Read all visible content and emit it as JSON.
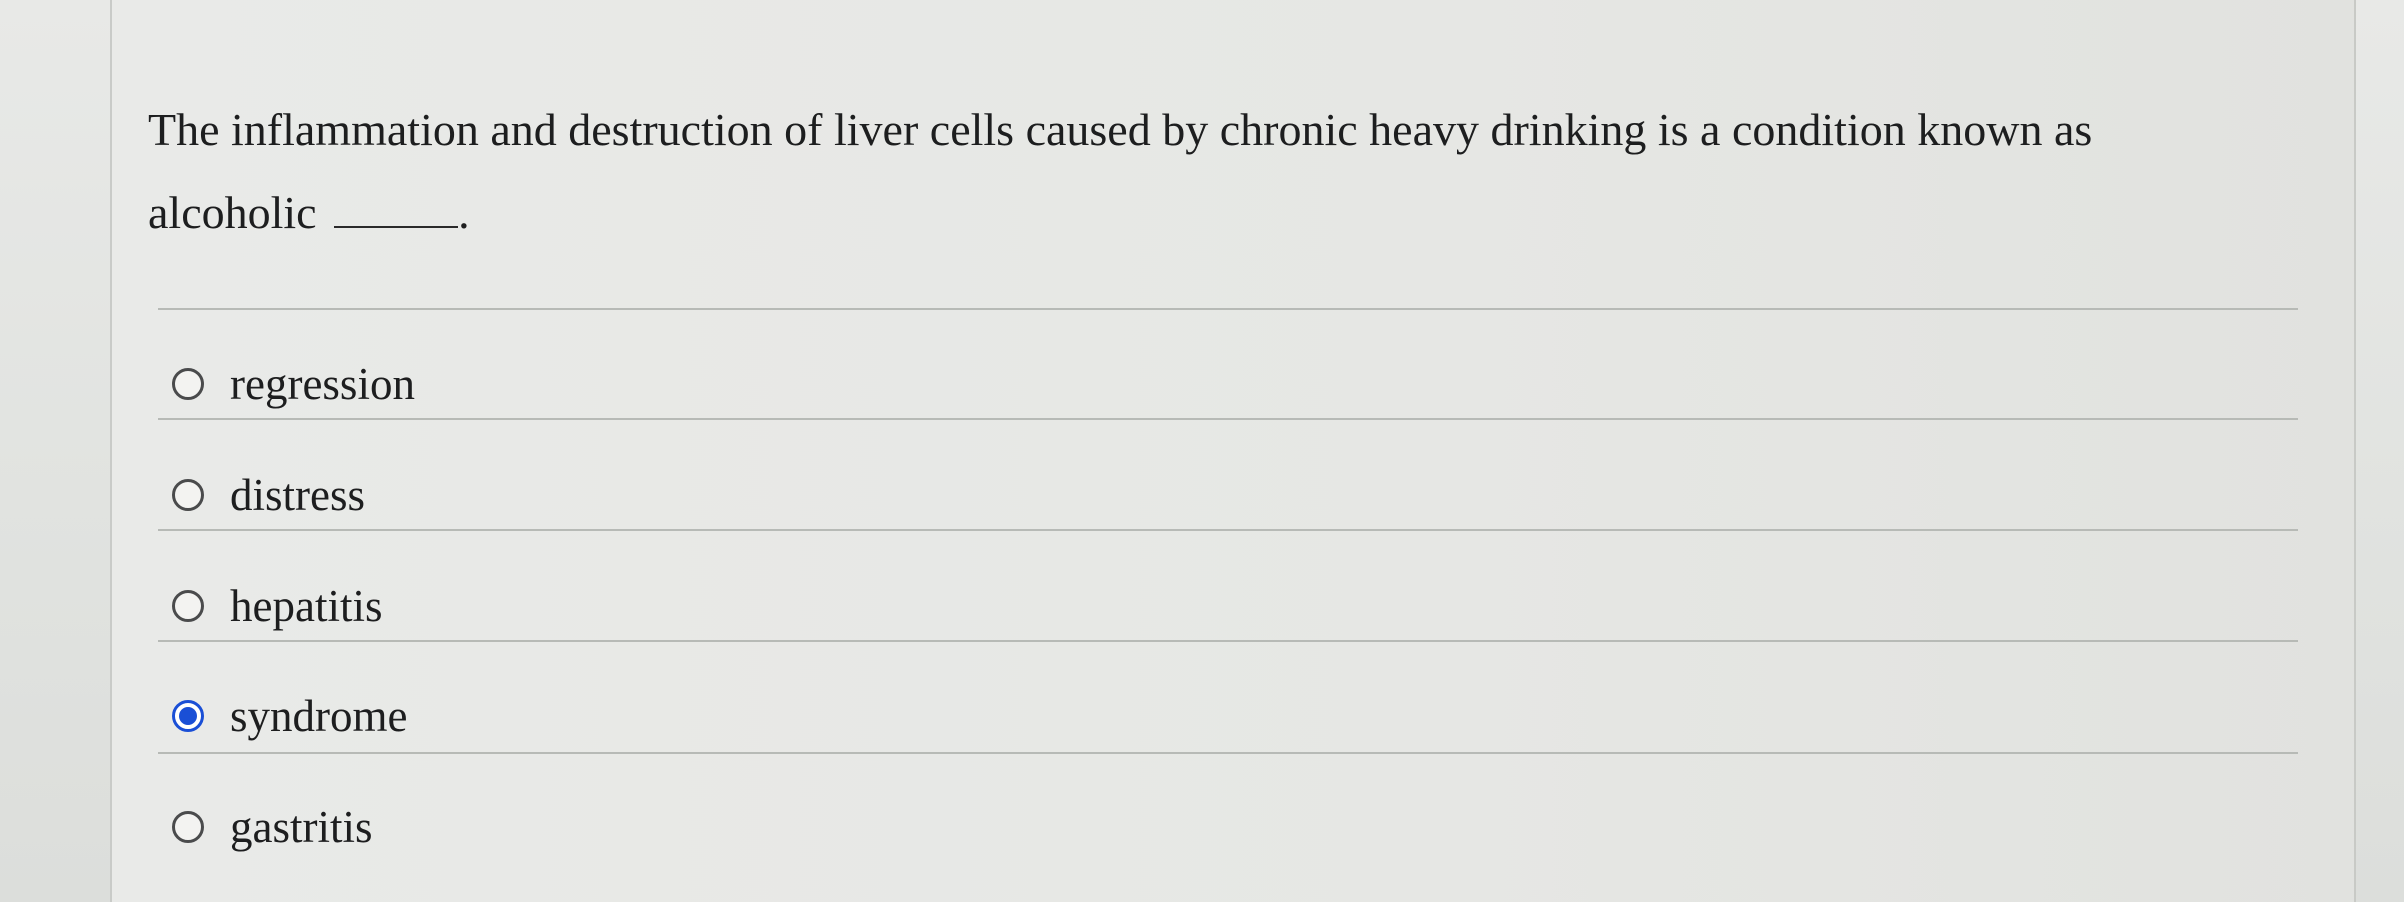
{
  "question": {
    "text": "The inflammation and destruction of liver cells caused by chronic heavy drinking is a condition known as alcoholic",
    "suffix": "."
  },
  "options": [
    {
      "label": "regression",
      "selected": false
    },
    {
      "label": "distress",
      "selected": false
    },
    {
      "label": "hepatitis",
      "selected": false
    },
    {
      "label": "syndrome",
      "selected": true
    },
    {
      "label": "gastritis",
      "selected": false
    }
  ],
  "colors": {
    "selected_radio": "#1a4fd6",
    "text": "#1d1e1f"
  }
}
